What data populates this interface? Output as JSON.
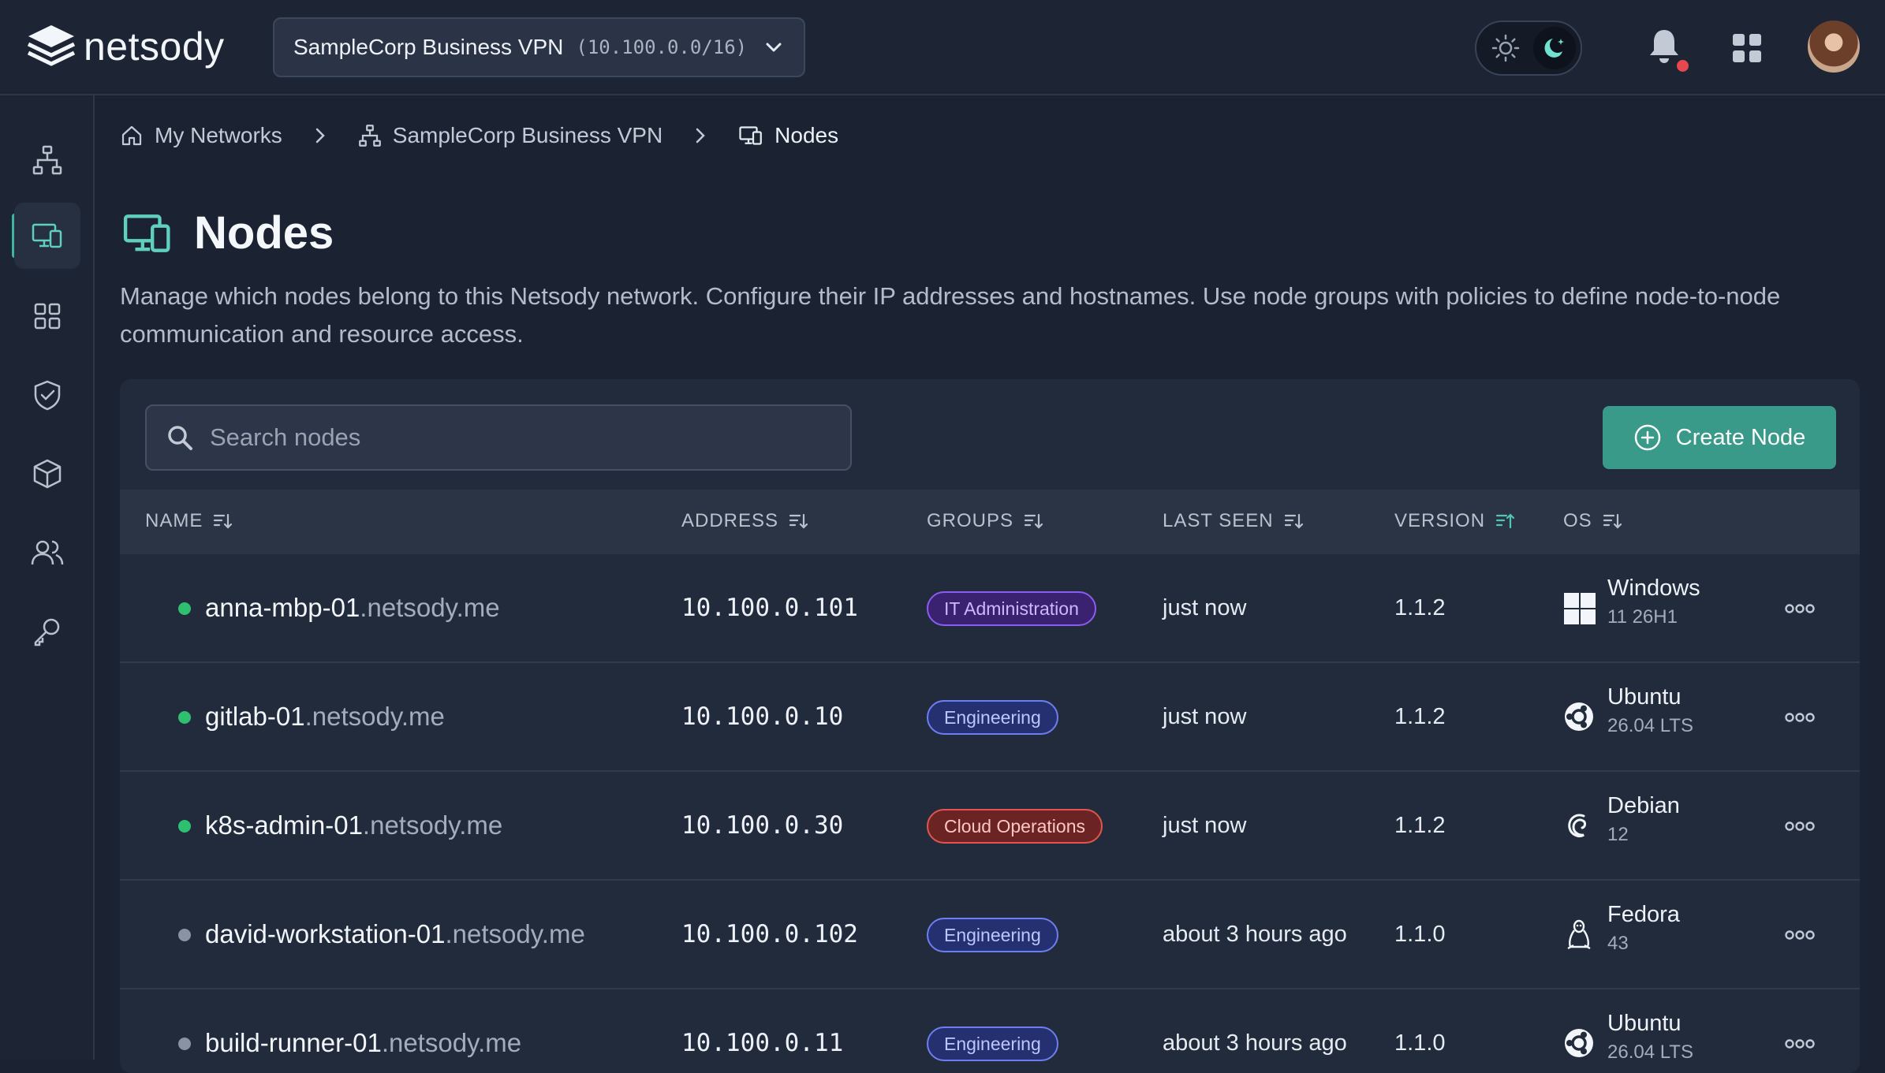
{
  "app": {
    "logo_text": "netsody"
  },
  "network_selector": {
    "name": "SampleCorp Business VPN",
    "cidr": "(10.100.0.0/16)"
  },
  "breadcrumb": {
    "home": "My Networks",
    "network": "SampleCorp Business VPN",
    "current": "Nodes"
  },
  "page": {
    "title": "Nodes",
    "description": "Manage which nodes belong to this Netsody network. Configure their IP addresses and hostnames. Use node groups with policies to define node-to-node communication and resource access."
  },
  "search": {
    "placeholder": "Search nodes"
  },
  "create_button": {
    "label": "Create Node"
  },
  "table": {
    "columns": {
      "name": "NAME",
      "address": "ADDRESS",
      "groups": "GROUPS",
      "last_seen": "LAST SEEN",
      "version": "VERSION",
      "os": "OS"
    },
    "rows": [
      {
        "host": "anna-mbp-01",
        "domain": ".netsody.me",
        "address": "10.100.0.101",
        "group": "IT Administration",
        "group_color": "purple",
        "last_seen": "just now",
        "version": "1.1.2",
        "os": "Windows",
        "os_version": "11 26H1",
        "os_icon": "windows-icon",
        "online": true
      },
      {
        "host": "gitlab-01",
        "domain": ".netsody.me",
        "address": "10.100.0.10",
        "group": "Engineering",
        "group_color": "blue",
        "last_seen": "just now",
        "version": "1.1.2",
        "os": "Ubuntu",
        "os_version": "26.04 LTS",
        "os_icon": "ubuntu-icon",
        "online": true
      },
      {
        "host": "k8s-admin-01",
        "domain": ".netsody.me",
        "address": "10.100.0.30",
        "group": "Cloud Operations",
        "group_color": "red",
        "last_seen": "just now",
        "version": "1.1.2",
        "os": "Debian",
        "os_version": "12",
        "os_icon": "debian-icon",
        "online": true
      },
      {
        "host": "david-workstation-01",
        "domain": ".netsody.me",
        "address": "10.100.0.102",
        "group": "Engineering",
        "group_color": "blue",
        "last_seen": "about 3 hours ago",
        "version": "1.1.0",
        "os": "Fedora",
        "os_version": "43",
        "os_icon": "linux-icon",
        "online": false
      },
      {
        "host": "build-runner-01",
        "domain": ".netsody.me",
        "address": "10.100.0.11",
        "group": "Engineering",
        "group_color": "blue",
        "last_seen": "about 3 hours ago",
        "version": "1.1.0",
        "os": "Ubuntu",
        "os_version": "26.04 LTS",
        "os_icon": "ubuntu-icon",
        "online": false
      }
    ]
  },
  "colors": {
    "accent": "#3a9a89",
    "online": "#2fbf71",
    "offline": "#8a93a3",
    "notification": "#e5484d"
  }
}
